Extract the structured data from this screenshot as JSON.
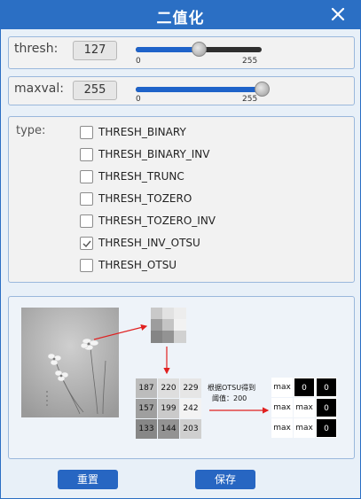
{
  "window": {
    "title": "二值化"
  },
  "thresh": {
    "label": "thresh:",
    "value": "127",
    "fraction": 0.498,
    "min_tick": "0",
    "max_tick": "255"
  },
  "maxval": {
    "label": "maxval:",
    "value": "255",
    "fraction": 1.0,
    "min_tick": "0",
    "max_tick": "255"
  },
  "type": {
    "label": "type:",
    "options": [
      {
        "label": "THRESH_BINARY",
        "checked": false
      },
      {
        "label": "THRESH_BINARY_INV",
        "checked": false
      },
      {
        "label": "THRESH_TRUNC",
        "checked": false
      },
      {
        "label": "THRESH_TOZERO",
        "checked": false
      },
      {
        "label": "THRESH_TOZERO_INV",
        "checked": false
      },
      {
        "label": "THRESH_INV_OTSU",
        "checked": true
      },
      {
        "label": "THRESH_OTSU",
        "checked": false
      }
    ]
  },
  "illustration": {
    "annotation_line1": "根据OTSU得到",
    "annotation_line2": "阈值：200",
    "input_grid": [
      [
        "187",
        "220",
        "229"
      ],
      [
        "157",
        "199",
        "242"
      ],
      [
        "133",
        "144",
        "203"
      ]
    ],
    "output_grid": [
      [
        "max",
        "0",
        "0"
      ],
      [
        "max",
        "max",
        "0"
      ],
      [
        "max",
        "max",
        "0"
      ]
    ],
    "colors": {
      "arrow": "#e02020",
      "dark_cell": "#000000",
      "light_cell": "#ffffff"
    }
  },
  "buttons": {
    "reset": "重置",
    "save": "保存"
  },
  "colors": {
    "accent": "#2b6fc4",
    "button": "#2766c2",
    "slider_fill": "#1f63c9"
  }
}
